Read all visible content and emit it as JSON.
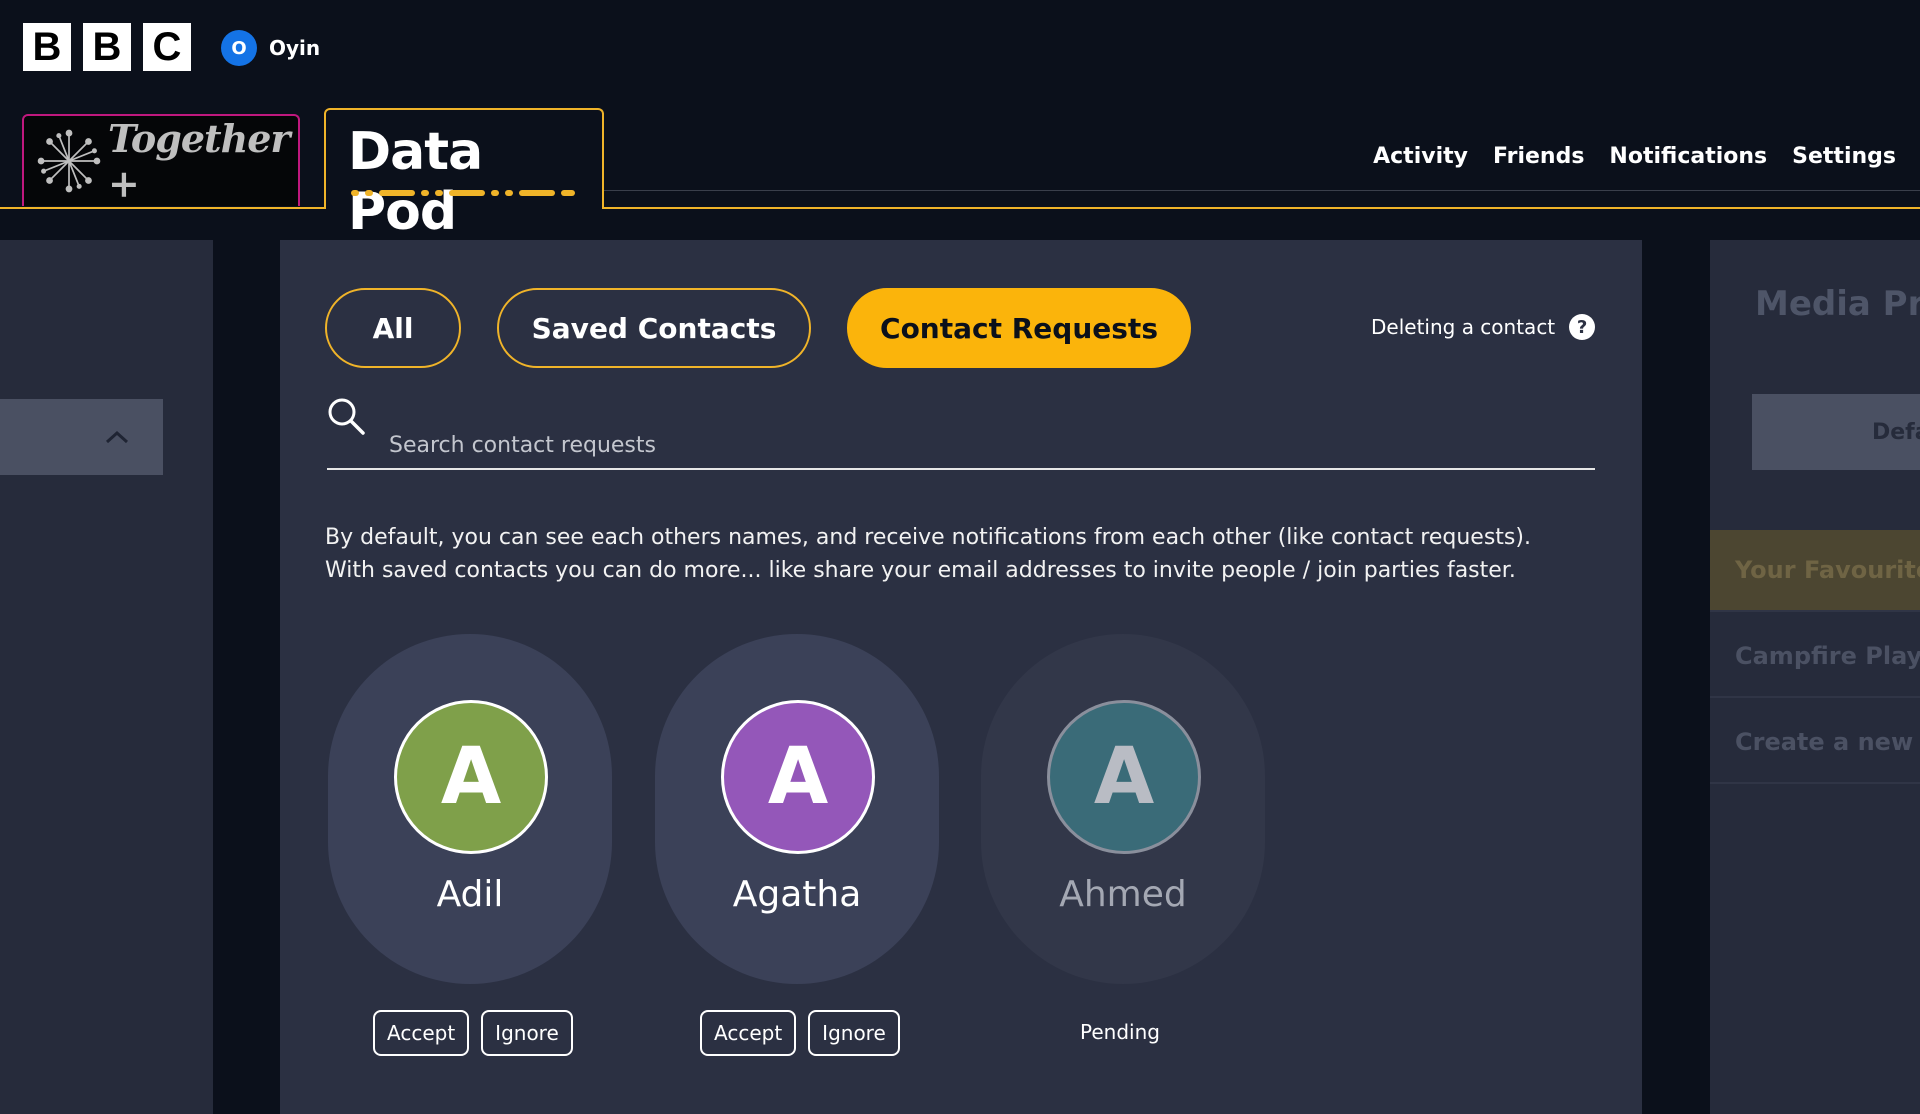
{
  "header": {
    "logo": [
      "B",
      "B",
      "C"
    ],
    "user": {
      "initial": "O",
      "name": "Oyin",
      "avatar_color": "#1473e6"
    }
  },
  "tabs": {
    "brand": {
      "label": "Together +",
      "icon": "starburst-icon",
      "border_color": "#c0187e"
    },
    "active": {
      "label": "Data Pod",
      "accent": "#f0b429"
    }
  },
  "topnav": [
    "Activity",
    "Friends",
    "Notifications",
    "Settings"
  ],
  "left_panel": {
    "collapse_icon": "chevron-up-icon"
  },
  "main": {
    "filters": [
      {
        "label": "All",
        "active": false
      },
      {
        "label": "Saved Contacts",
        "active": false
      },
      {
        "label": "Contact Requests",
        "active": true
      }
    ],
    "help": {
      "label": "Deleting a contact",
      "icon": "question-icon",
      "glyph": "?"
    },
    "search": {
      "placeholder": "Search contact requests",
      "icon": "search-icon"
    },
    "info": [
      "By default, you can see each others names, and receive notifications from each other (like contact requests).",
      "With saved contacts you can do more... like share your email addresses to invite people / join parties faster."
    ],
    "contacts": [
      {
        "initial": "A",
        "name": "Adil",
        "color": "#7fa04a",
        "status": "request",
        "accept": "Accept",
        "ignore": "Ignore"
      },
      {
        "initial": "A",
        "name": "Agatha",
        "color": "#9457b9",
        "status": "request",
        "accept": "Accept",
        "ignore": "Ignore"
      },
      {
        "initial": "A",
        "name": "Ahmed",
        "color": "#3a6b78",
        "status": "pending",
        "pending": "Pending"
      }
    ]
  },
  "right_panel": {
    "title": "Media Pro",
    "button": "Defa",
    "items": [
      "Your Favourite",
      "Campfire Playl",
      "Create a new li"
    ]
  },
  "colors": {
    "accent": "#fbb40b",
    "background": "#0b101b",
    "panel": "#2b3042"
  }
}
